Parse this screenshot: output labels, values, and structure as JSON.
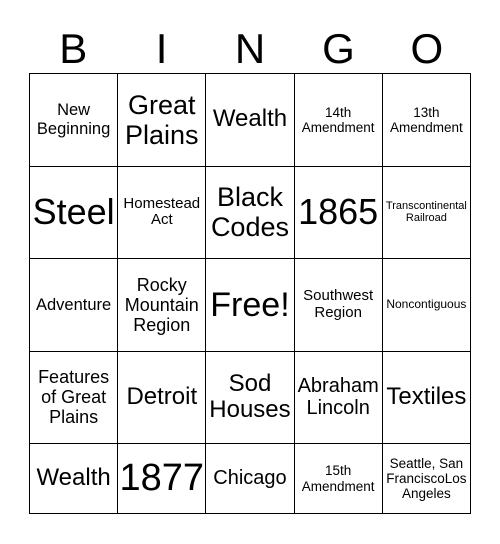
{
  "header": [
    "B",
    "I",
    "N",
    "G",
    "O"
  ],
  "rows": [
    [
      "New Beginning",
      "Great Plains",
      "Wealth",
      "14th Amendment",
      "13th Amendment"
    ],
    [
      "Steel",
      "Homestead Act",
      "Black Codes",
      "1865",
      "Transcontinental Railroad"
    ],
    [
      "Adventure",
      "Rocky Mountain Region",
      "Free!",
      "Southwest Region",
      "Noncontiguous"
    ],
    [
      "Features of Great Plains",
      "Detroit",
      "Sod Houses",
      "Abraham Lincoln",
      "Textiles"
    ],
    [
      "Wealth",
      "1877",
      "Chicago",
      "15th Amendment",
      "Seattle, San FranciscoLos Angeles"
    ]
  ]
}
